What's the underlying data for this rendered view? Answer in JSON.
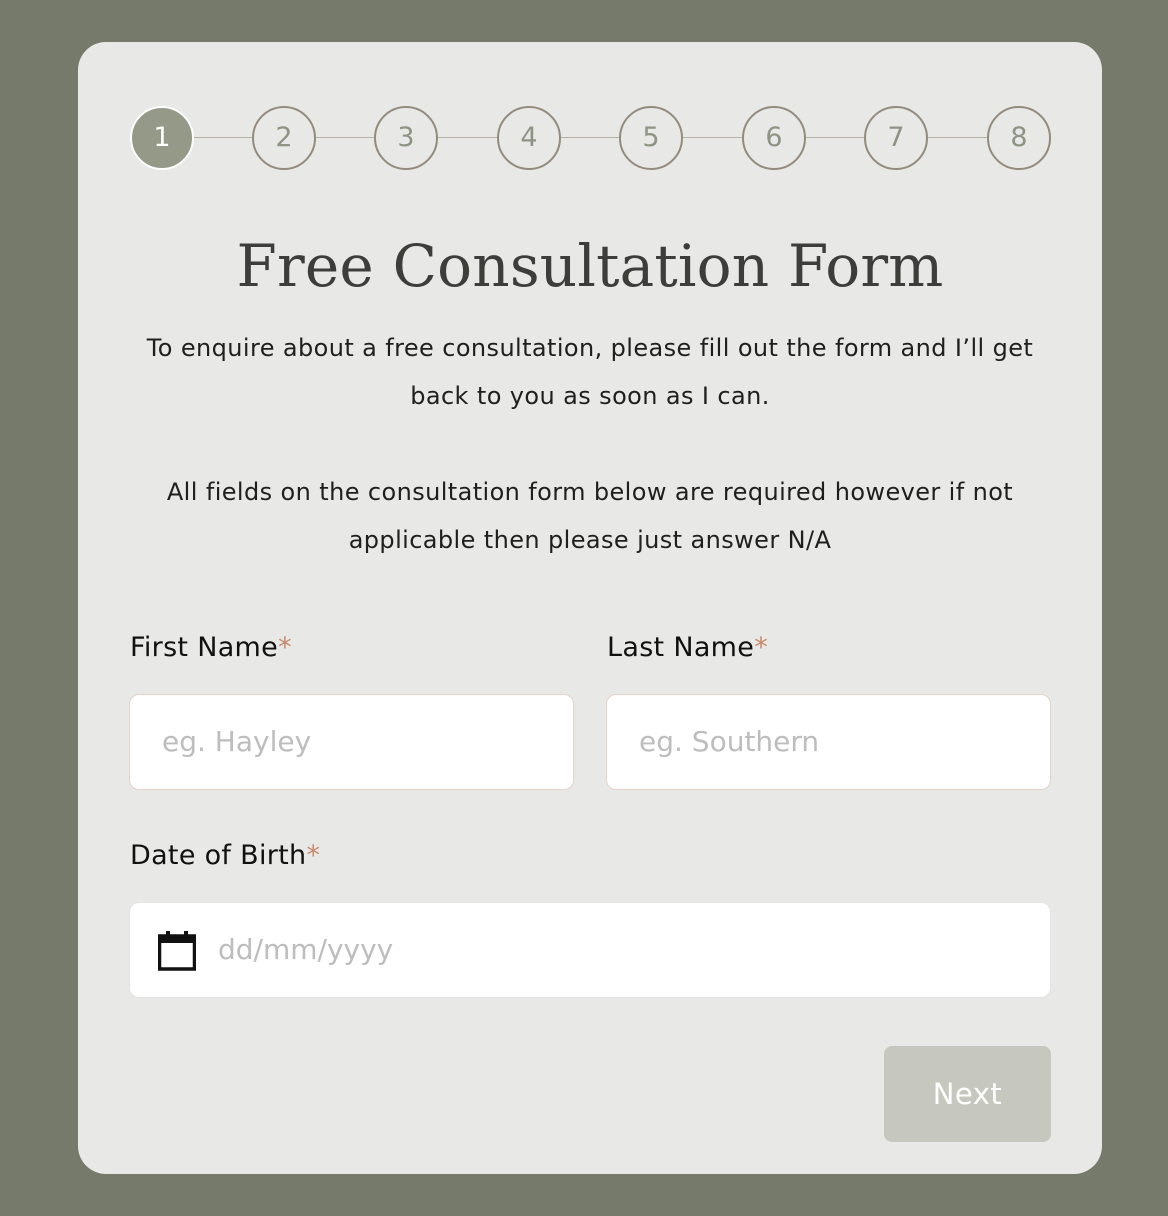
{
  "stepper": {
    "steps": [
      "1",
      "2",
      "3",
      "4",
      "5",
      "6",
      "7",
      "8"
    ],
    "active_step": 1
  },
  "form": {
    "title": "Free Consultation Form",
    "intro_1": "To enquire about a free consultation, please fill out the form and I’ll get back to you as soon as I can.",
    "intro_2": "All fields on the consultation form below are required however if not applicable then please just answer N/A",
    "required_marker": "*",
    "first_name": {
      "label": "First Name",
      "placeholder": "eg. Hayley",
      "value": ""
    },
    "last_name": {
      "label": "Last Name",
      "placeholder": "eg. Southern",
      "value": ""
    },
    "dob": {
      "label": "Date of Birth",
      "placeholder": "dd/mm/yyyy",
      "value": ""
    },
    "next_label": "Next"
  },
  "colors": {
    "background": "#767a6b",
    "card": "#e8e8e6",
    "step_active": "#959a88",
    "step_border": "#948b7c",
    "required": "#c78a6c",
    "button_disabled": "#c6c8bf"
  },
  "icons": {
    "dob": "calendar-icon"
  }
}
